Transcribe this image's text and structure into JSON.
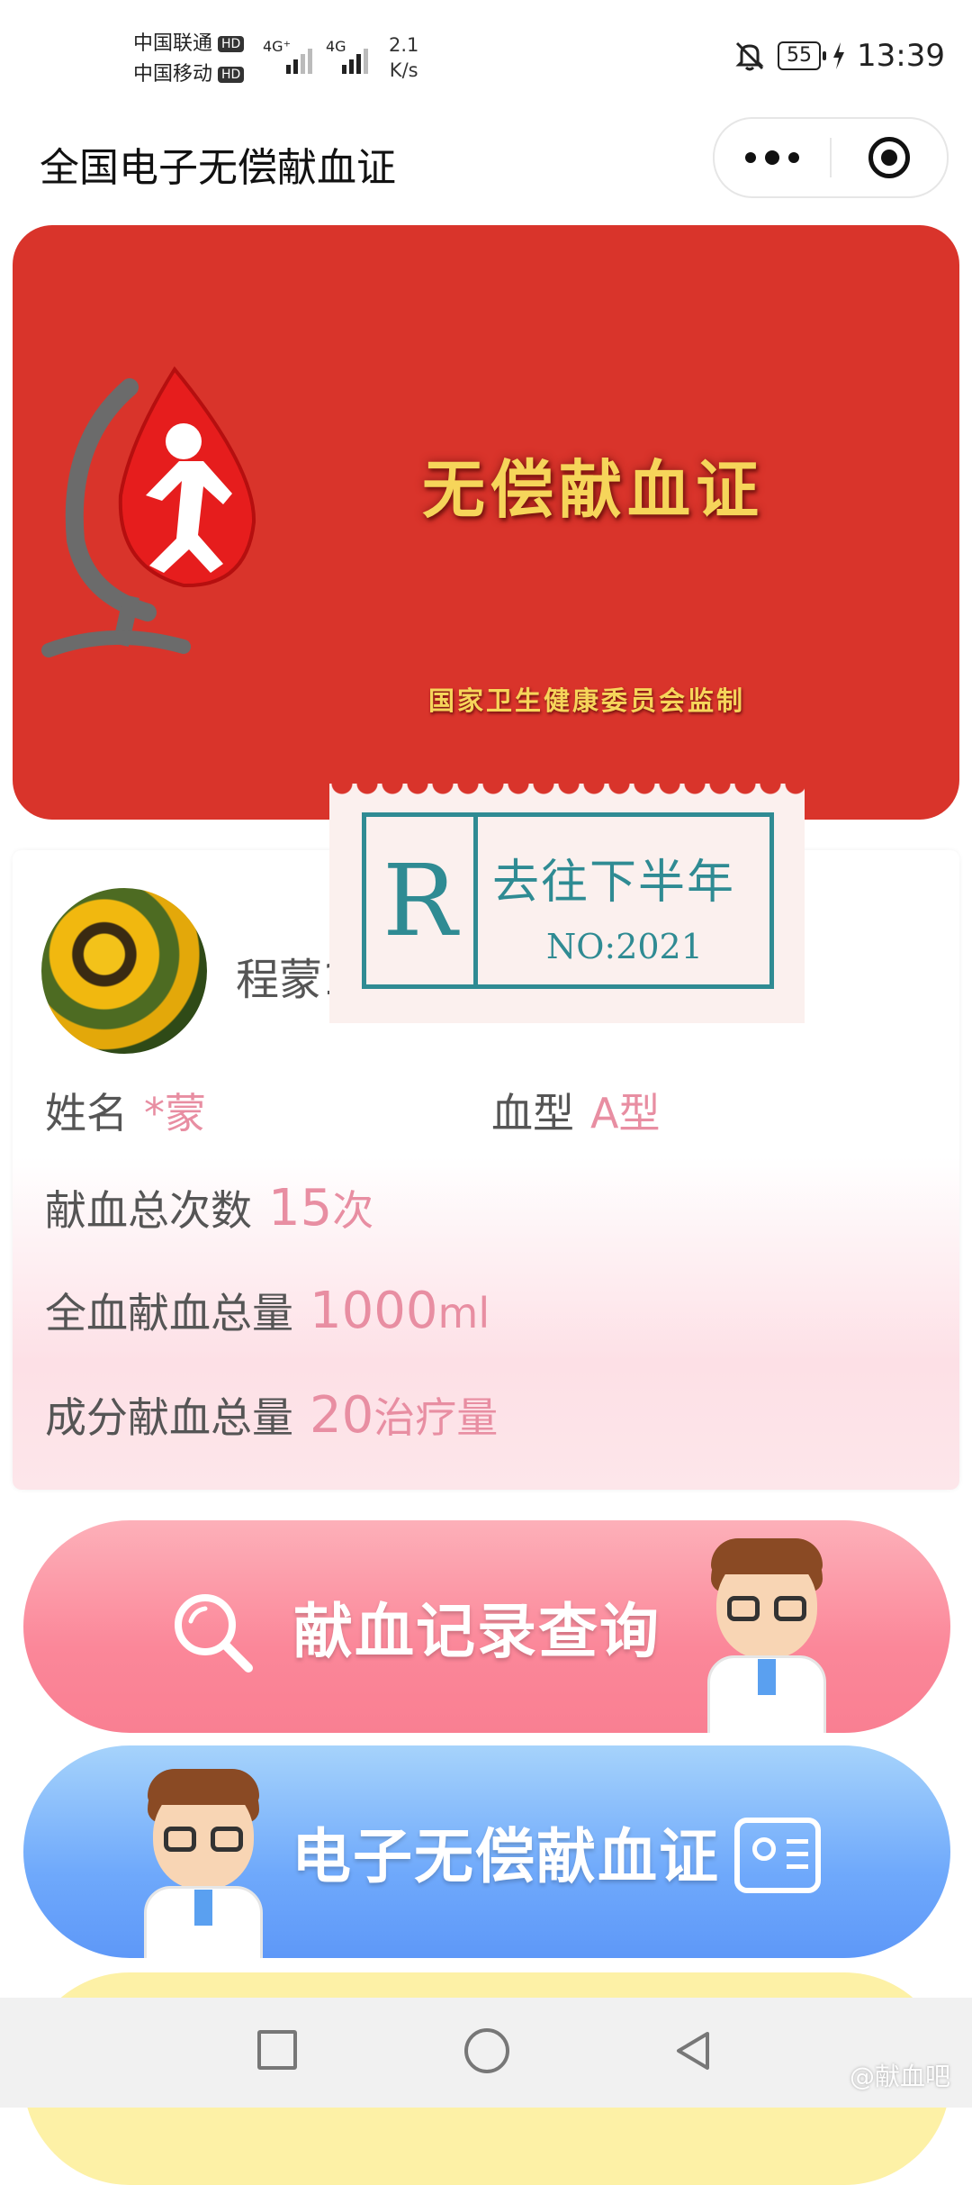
{
  "status_bar": {
    "carrier1": "中国联通",
    "carrier2": "中国移动",
    "hd": "HD",
    "network1": "4G⁺",
    "network2": "4G",
    "net_speed_value": "2.1",
    "net_speed_unit": "K/s",
    "battery": "55",
    "time": "13:39"
  },
  "titlebar": {
    "title": "全国电子无偿献血证"
  },
  "card": {
    "title": "无偿献血证",
    "subtitle": "国家卫生健康委员会监制",
    "colors": {
      "background": "#d9342b",
      "gold": "#f6d55a"
    }
  },
  "stamp": {
    "letter": "R",
    "line1": "去往下半年",
    "line2": "NO:2021"
  },
  "profile": {
    "username": "程蒙1",
    "name_label": "姓名",
    "name_value": "*蒙",
    "blood_type_label": "血型",
    "blood_type_value": "A型",
    "total_count_label": "献血总次数",
    "total_count_number": "15",
    "total_count_unit": "次",
    "whole_blood_label": "全血献血总量",
    "whole_blood_number": "1000",
    "whole_blood_unit": "ml",
    "component_label": "成分献血总量",
    "component_number": "20",
    "component_unit": "治疗量"
  },
  "actions": {
    "records_label": "献血记录查询",
    "certificate_label": "电子无偿献血证"
  },
  "watermark": "@献血吧"
}
